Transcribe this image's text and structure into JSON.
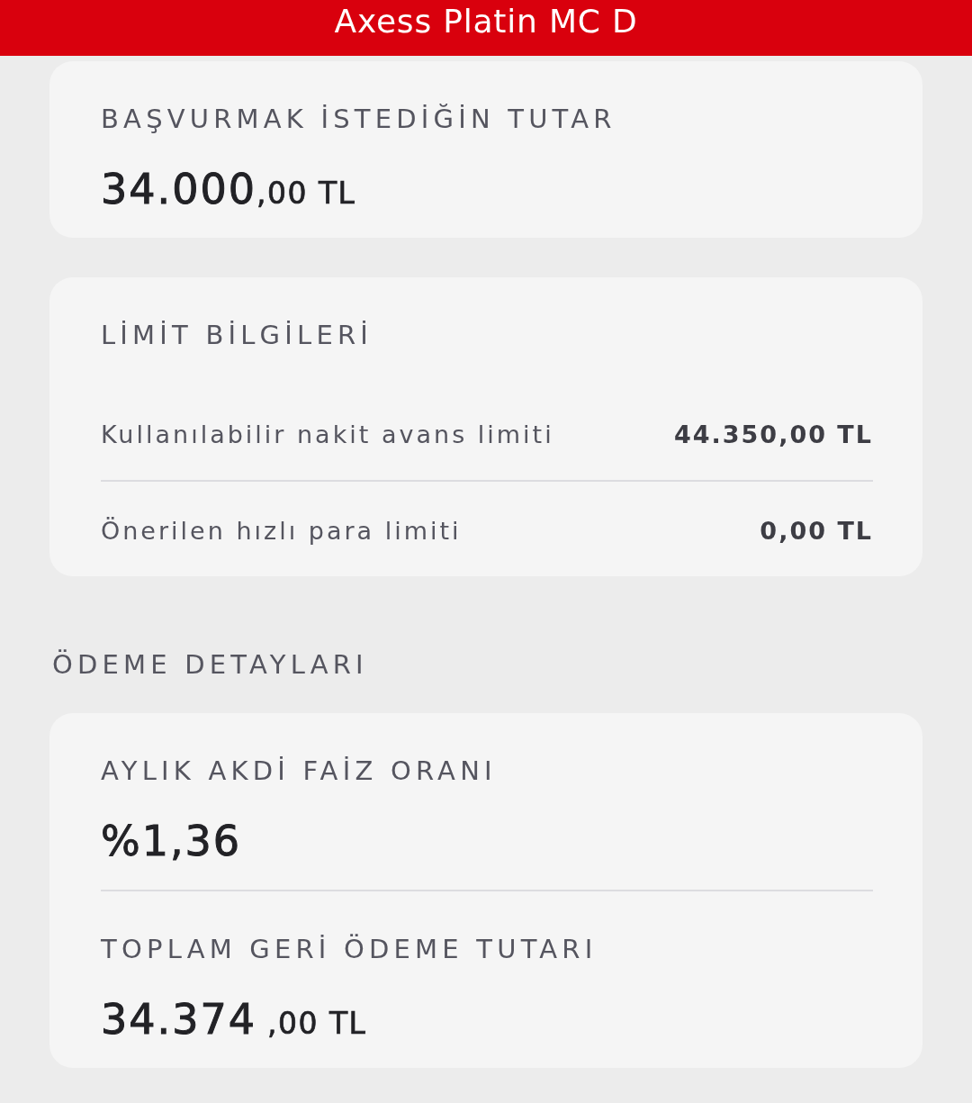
{
  "header": {
    "title": "Axess Platin MC D"
  },
  "requested_amount": {
    "label": "BAŞVURMAK İSTEDİĞİN TUTAR",
    "value_whole": "34.000",
    "value_fraction": ",00 TL"
  },
  "limit_info": {
    "title": "LİMİT BİLGİLERİ",
    "rows": [
      {
        "label": "Kullanılabilir nakit avans limiti",
        "value": "44.350,00 TL"
      },
      {
        "label": "Önerilen hızlı para limiti",
        "value": "0,00 TL"
      }
    ]
  },
  "payment_details": {
    "heading": "ÖDEME DETAYLARI",
    "items": [
      {
        "label": "AYLIK AKDİ FAİZ ORANI",
        "value_whole": "%1,36"
      },
      {
        "label": "TOPLAM GERİ ÖDEME TUTARI",
        "value_whole": "34.374",
        "value_fraction": " ,00 TL"
      }
    ]
  }
}
